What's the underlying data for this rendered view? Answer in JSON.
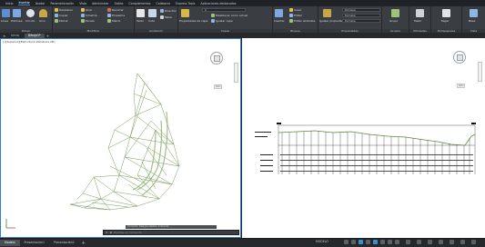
{
  "menu": {
    "items": [
      "Inicio",
      "Insertar",
      "Anotar",
      "Parametrización",
      "Vista",
      "Administrar",
      "Salida",
      "Complementos",
      "Colaborar",
      "Express Tools",
      "Aplicaciones destacadas"
    ],
    "active_index": 1
  },
  "ribbon": {
    "draw": {
      "title": "Dibujo",
      "line": "Línea",
      "polyline": "Polilínea",
      "circle": "Círculo",
      "arc": "Arco"
    },
    "modify": {
      "title": "Modificar",
      "move": "Desplazar",
      "rotate": "Girar",
      "trim": "Recortar",
      "copy": "Copiar",
      "mirror": "Simetría",
      "fillet": "Empalme",
      "stretch": "Estirar",
      "scale": "Escala",
      "array": "Matriz"
    },
    "annotation": {
      "title": "Anotación",
      "text": "Texto",
      "dimension": "Cota",
      "leader": "Directriz",
      "table": "Tabla"
    },
    "layers": {
      "title": "Capas",
      "properties": "Propiedades de capa",
      "current_layer": "0",
      "make_current": "Establecer como actual",
      "match": "Igualar capa"
    },
    "block": {
      "title": "Bloque",
      "insert": "Insertar",
      "create": "Crear",
      "edit": "Editar",
      "edit_attributes": "Editar atributos"
    },
    "properties": {
      "title": "Propiedades",
      "match": "Igualar propiedades",
      "color": "PorCapa",
      "linetype": "PorCapa",
      "lineweight": "PorCapa"
    },
    "groups": {
      "title": "Grupos",
      "group": "Grupo"
    },
    "utilities": {
      "title": "Utilidades",
      "measure": "Medir"
    },
    "clipboard": {
      "title": "Portapapeles",
      "paste": "Pegar"
    },
    "view": {
      "title": "Vista",
      "base": "Base"
    }
  },
  "tabs": {
    "items": [
      "Inicio",
      "Dibujo1*"
    ],
    "active_index": 1
  },
  "viewport_left": {
    "label": "[-][Superior][Estructura alámbrica 2D]",
    "wcs": "SCU"
  },
  "viewport_right": {
    "wcs": "SCU"
  },
  "command": {
    "history": "Comando: Designe objetos: Comando:",
    "prompt": "Escriba un comando"
  },
  "status": {
    "layout_tabs": [
      "Modelo",
      "Presentación1",
      "Presentación2"
    ],
    "active_index": 0,
    "mode": "MODELO"
  },
  "colors": {
    "ribbon_bg": "#3a3d42",
    "canvas_bg": "#ffffff",
    "terrain_line": "#7a9a5a",
    "profile_line": "#5a8a3a",
    "accent": "#3c8fd6"
  }
}
